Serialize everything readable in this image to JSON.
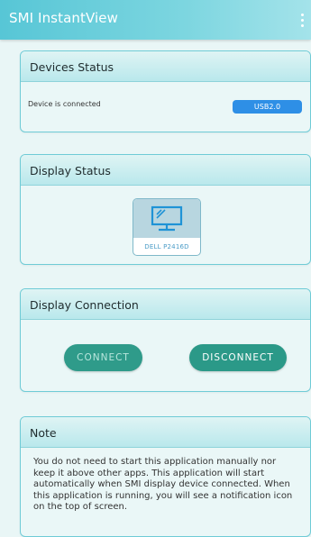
{
  "app": {
    "title": "SMI InstantView"
  },
  "devices": {
    "title": "Devices Status",
    "status": "Device is connected",
    "badge": "USB2.0"
  },
  "display": {
    "title": "Display Status",
    "monitor_name": "DELL P2416D"
  },
  "connection": {
    "title": "Display Connection",
    "connect_label": "CONNECT",
    "disconnect_label": "DISCONNECT"
  },
  "note": {
    "title": "Note",
    "body": "You do not need to start this application manually nor keep it above other apps. This application will start automatically when SMI display device connected. When this application is running, you will see a notification icon on the top of screen."
  },
  "colors": {
    "app_bar": "#57c6d6",
    "badge": "#2e8fe6",
    "button": "#2b9988",
    "card_border": "#6fcbd6"
  },
  "icons": {
    "menu": "more-vert-icon",
    "monitor": "monitor-icon"
  }
}
